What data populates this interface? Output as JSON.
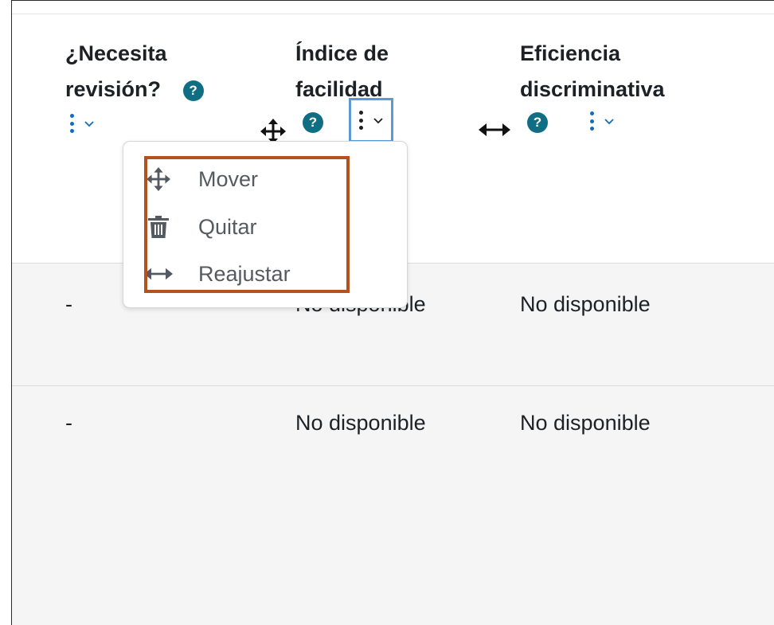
{
  "columns": [
    {
      "title_line1": "¿Necesita",
      "title_line2": "revisión?",
      "help_icon": "?"
    },
    {
      "title_line1": "Índice de",
      "title_line2": "facilidad",
      "help_icon": "?"
    },
    {
      "title_line1": "Eficiencia",
      "title_line2": "discriminativa",
      "help_icon": "?"
    }
  ],
  "rows": [
    {
      "needs_review": "-",
      "facility": "No disponible",
      "discrimination": "No disponible"
    },
    {
      "needs_review": "-",
      "facility": "No disponible",
      "discrimination": "No disponible"
    }
  ],
  "menu": {
    "items": [
      {
        "label": "Mover",
        "icon": "move-icon"
      },
      {
        "label": "Quitar",
        "icon": "trash-icon"
      },
      {
        "label": "Reajustar",
        "icon": "resize-horizontal-icon"
      }
    ]
  },
  "colors": {
    "help_badge": "#0f6e84",
    "link_blue": "#0f6cbf",
    "focus_outline": "#5b9bd5",
    "highlight_box": "#b5501f",
    "row_background": "#f5f5f5"
  }
}
